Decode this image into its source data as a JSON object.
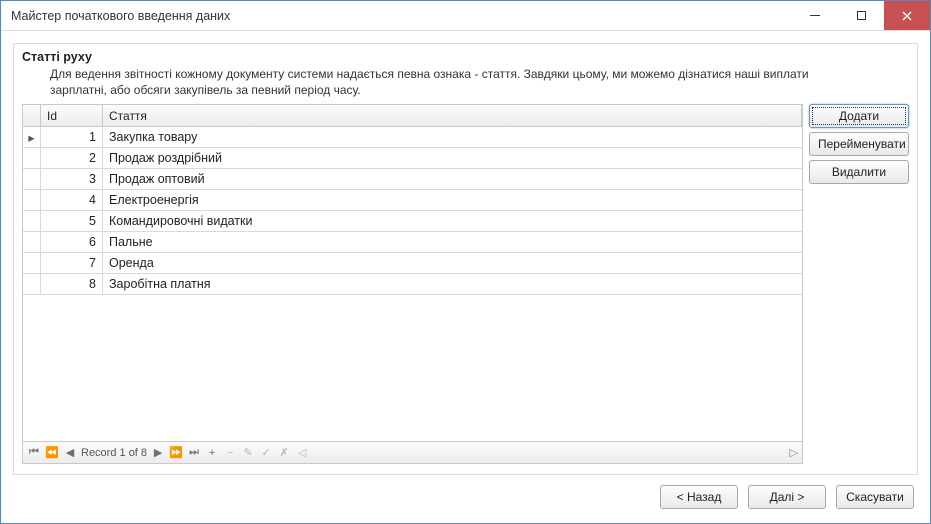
{
  "window": {
    "title": "Майстер початкового введення даних"
  },
  "group": {
    "title": "Статті руху",
    "description": "Для ведення звітності кожному документу системи надається певна ознака - стаття. Завдяки цьому, ми можемо дізнатися наші виплати зарплатні, або обсяги закупівель за певний період часу."
  },
  "grid": {
    "columns": {
      "id": "Id",
      "name": "Стаття"
    },
    "rows": [
      {
        "id": "1",
        "name": "Закупка товару"
      },
      {
        "id": "2",
        "name": "Продаж роздрібний"
      },
      {
        "id": "3",
        "name": "Продаж оптовий"
      },
      {
        "id": "4",
        "name": "Електроенергія"
      },
      {
        "id": "5",
        "name": "Командировочні видатки"
      },
      {
        "id": "6",
        "name": "Пальне"
      },
      {
        "id": "7",
        "name": "Оренда"
      },
      {
        "id": "8",
        "name": "Заробітна платня"
      }
    ],
    "nav_status": "Record 1 of 8"
  },
  "side": {
    "add": "Додати",
    "rename": "Перейменувати",
    "delete": "Видалити"
  },
  "footer": {
    "back": "< Назад",
    "next": "Далі >",
    "cancel": "Скасувати"
  }
}
